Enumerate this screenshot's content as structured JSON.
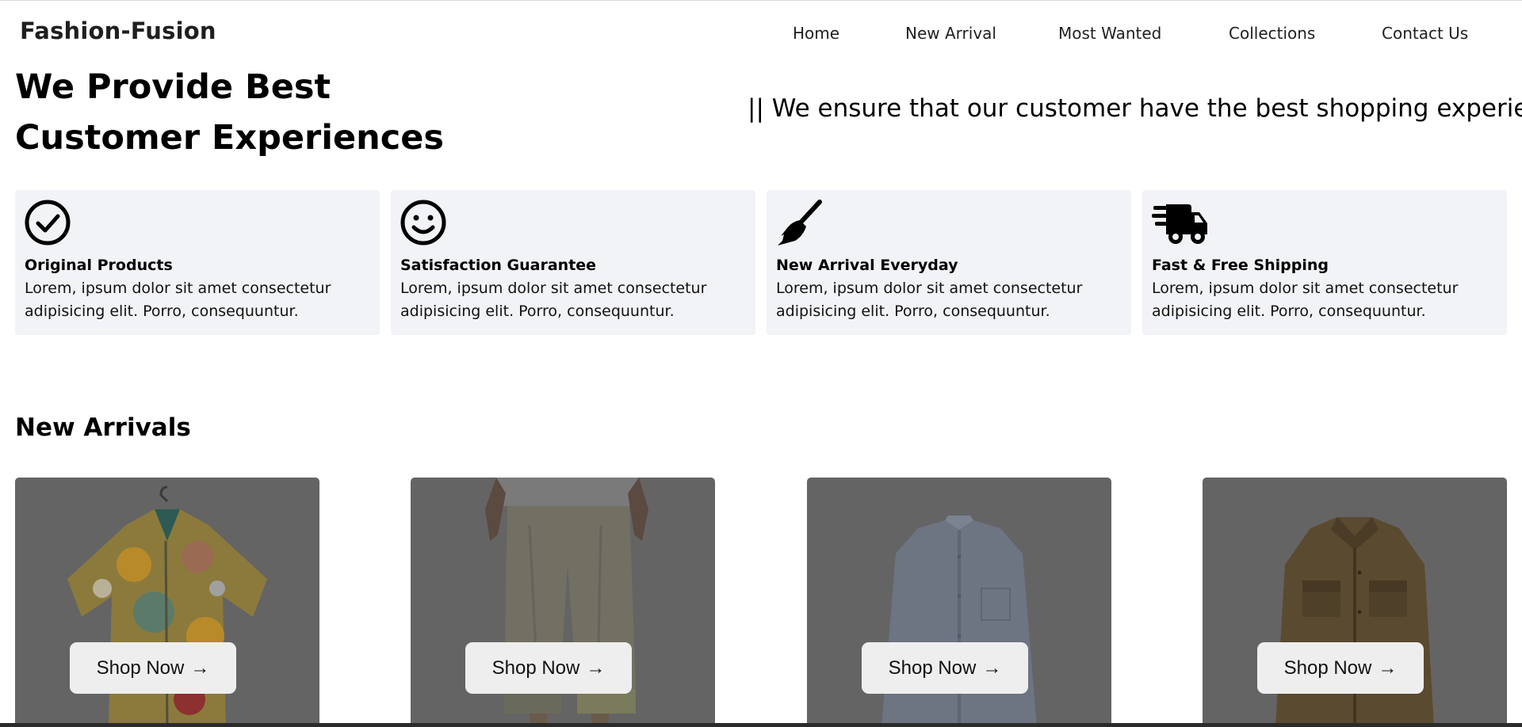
{
  "header": {
    "logo": "Fashion-Fusion",
    "nav": [
      "Home",
      "New Arrival",
      "Most Wanted",
      "Collections",
      "Contact Us"
    ]
  },
  "hero": {
    "title_line1": "We Provide Best",
    "title_line2": "Customer Experiences",
    "tagline": "|| We ensure that our customer have the best shopping experience"
  },
  "features": [
    {
      "icon": "check-circle-icon",
      "title": "Original Products",
      "desc": "Lorem, ipsum dolor sit amet consectetur adipisicing elit. Porro, consequuntur."
    },
    {
      "icon": "smiley-face-icon",
      "title": "Satisfaction Guarantee",
      "desc": "Lorem, ipsum dolor sit amet consectetur adipisicing elit. Porro, consequuntur."
    },
    {
      "icon": "broom-icon",
      "title": "New Arrival Everyday",
      "desc": "Lorem, ipsum dolor sit amet consectetur adipisicing elit. Porro, consequuntur."
    },
    {
      "icon": "fast-truck-icon",
      "title": "Fast & Free Shipping",
      "desc": "Lorem, ipsum dolor sit amet consectetur adipisicing elit. Porro, consequuntur."
    }
  ],
  "new_arrivals": {
    "title": "New Arrivals",
    "products": [
      {
        "image": "floral-shirt-image",
        "button": "Shop Now"
      },
      {
        "image": "linen-trousers-image",
        "button": "Shop Now"
      },
      {
        "image": "blue-shirt-image",
        "button": "Shop Now"
      },
      {
        "image": "brown-jacket-image",
        "button": "Shop Now"
      }
    ]
  },
  "colors": {
    "card_bg": "#646464",
    "feature_bg": "#f2f3f6",
    "button_bg": "#eeeeee"
  }
}
